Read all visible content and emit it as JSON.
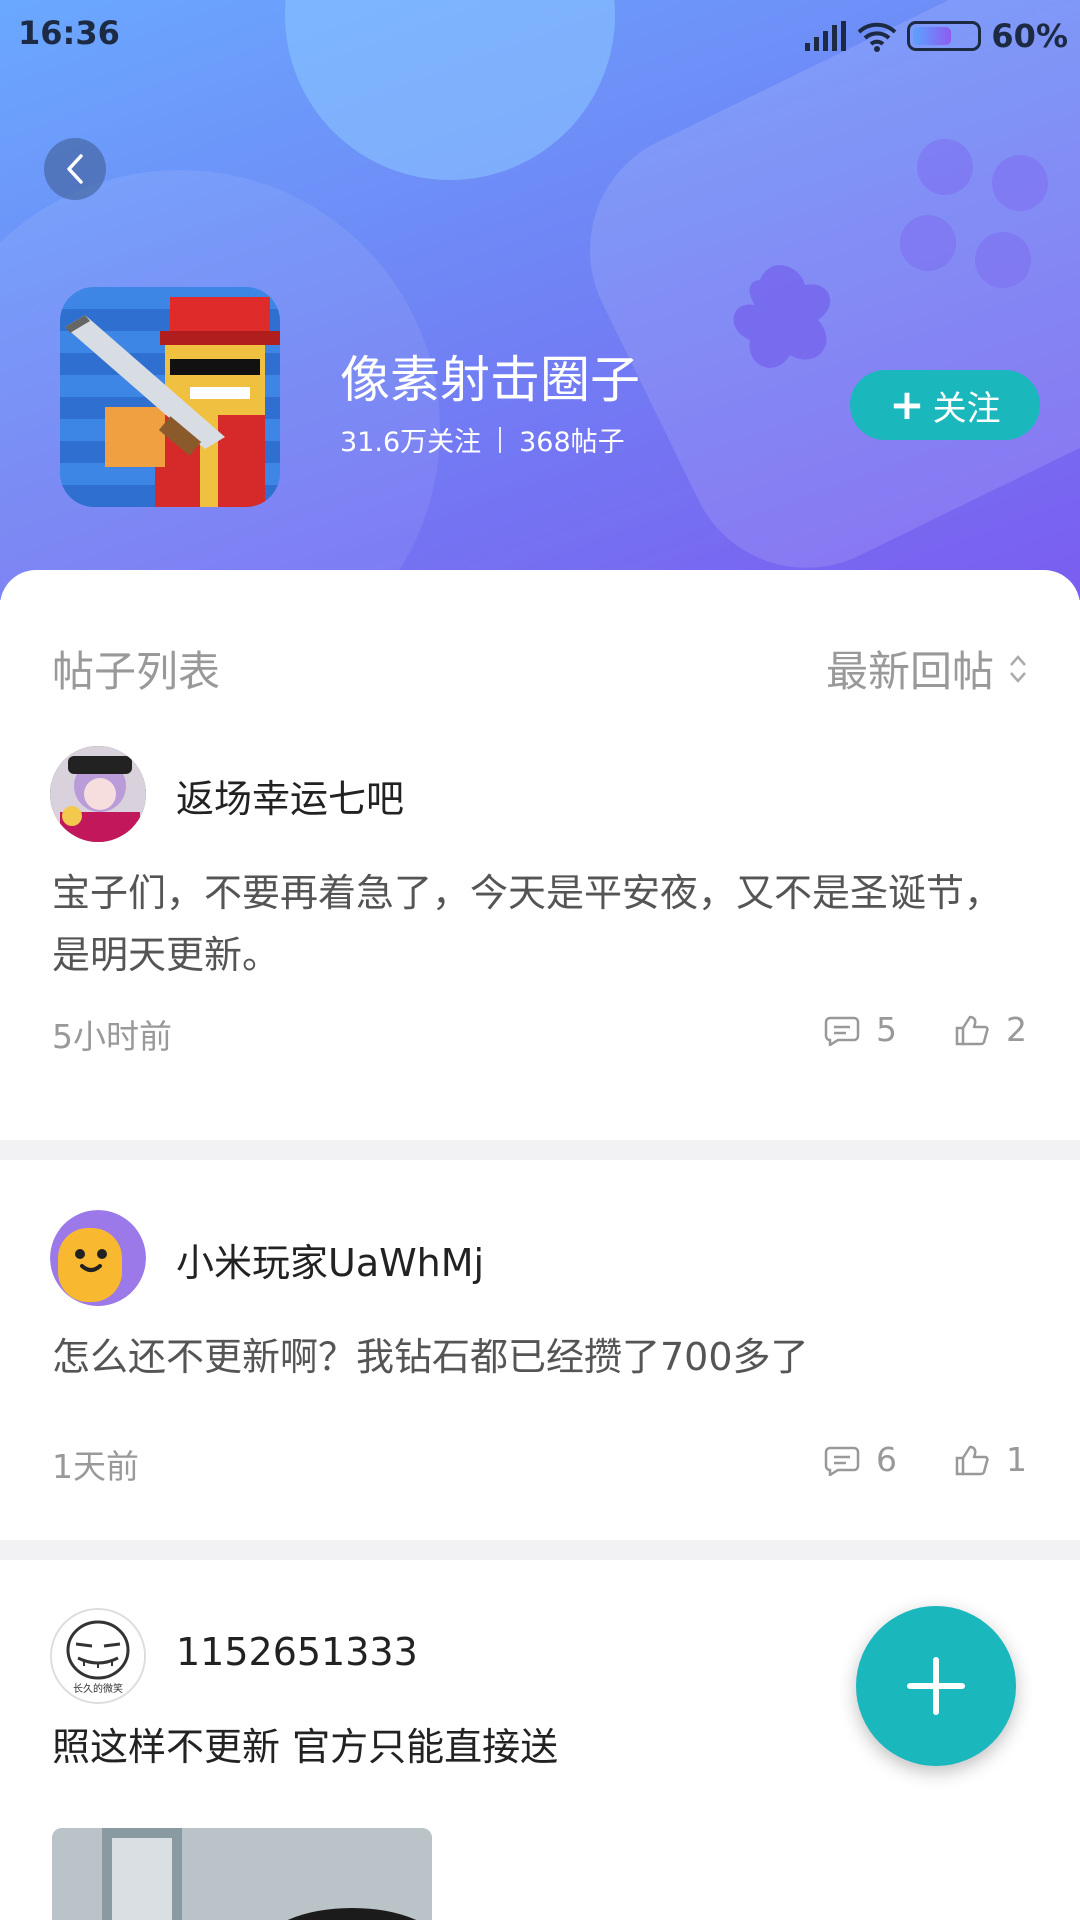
{
  "status_bar": {
    "time": "16:36",
    "battery": "60%"
  },
  "circle": {
    "name": "像素射击圈子",
    "followers": "31.6万关注",
    "posts": "368帖子",
    "follow_label": "关注"
  },
  "list": {
    "title": "帖子列表",
    "sort_label": "最新回帖"
  },
  "posts": [
    {
      "author": "返场幸运七吧",
      "text": "宝子们，不要再着急了，今天是平安夜，又不是圣诞节，是明天更新。",
      "time": "5小时前",
      "comments": "5",
      "likes": "2"
    },
    {
      "author": "小米玩家UaWhMj",
      "text": "怎么还不更新啊？我钻石都已经攒了700多了",
      "time": "1天前",
      "comments": "6",
      "likes": "1"
    },
    {
      "author": "1152651333",
      "text": "照这样不更新 官方只能直接送",
      "avatar_caption": "长久的微笑"
    }
  ],
  "colors": {
    "accent": "#1ab7bd",
    "header_start": "#6aa8ff",
    "header_end": "#7b5df0"
  }
}
